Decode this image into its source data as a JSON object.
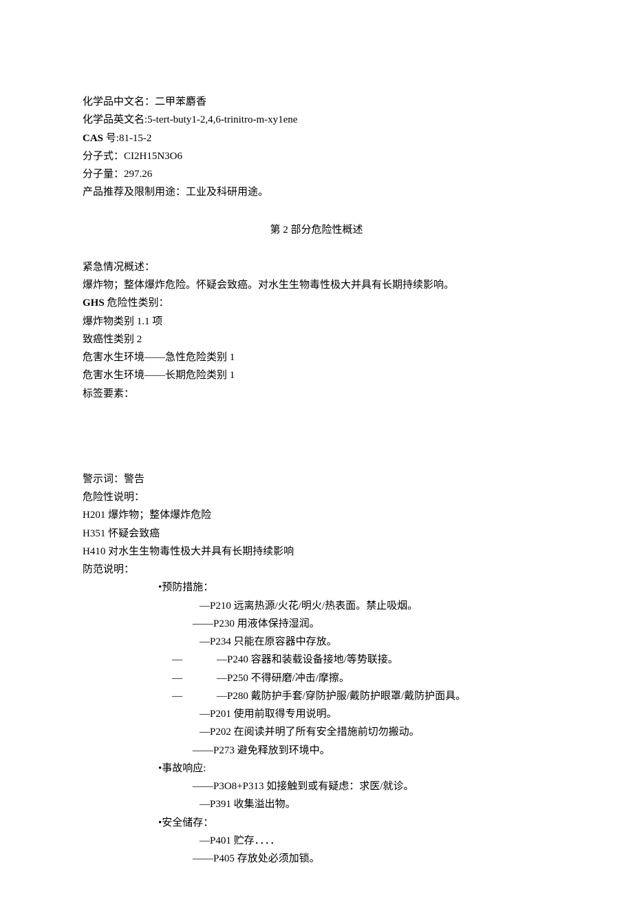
{
  "identification": {
    "cn_name_label": "化学品中文名：",
    "cn_name": "二甲苯麝香",
    "en_name_label": "化学品英文名:",
    "en_name": "5-tert-buty1-2,4,6-trinitro-m-xy1ene",
    "cas_label": "CAS",
    "cas_suffix": " 号:",
    "cas_no": "81-15-2",
    "formula_label": "分子式：",
    "formula": "CI2H15N3O6",
    "mw_label": "分子量：",
    "mw": "297.26",
    "use_label": "产品推荐及限制用途：工业及科研用途。"
  },
  "section2_title": "第 2 部分危险性概述",
  "hazard": {
    "emergency_label": "紧急情况概述：",
    "emergency_text": "爆炸物；整体爆炸危险。怀疑会致癌。对水生生物毒性极大并具有长期持续影响。",
    "ghs_label": "GHS",
    "ghs_suffix": " 危险性类别：",
    "cat1": "爆炸物类别 1.1 项",
    "cat2": "致癌性类别 2",
    "cat3": "危害水生环境——急性危险类别 1",
    "cat4": "危害水生环境——长期危险类别 1",
    "label_elements": "标签要素：",
    "signal_word": "警示词：警告",
    "hazard_stmt_label": "危险性说明：",
    "h201": "H201 爆炸物；整体爆炸危险",
    "h351": "H351 怀疑会致癌",
    "h410": "H410 对水生生物毒性极大并具有长期持续影响",
    "precaution_label": "防范说明：",
    "prevention_label": "•预防措施：",
    "p210": "—P210 远离热源/火花/明火/热表面。禁止吸烟。",
    "p230": "——P230 用液体保持湿润。",
    "p234": "—P234 只能在原容器中存放。",
    "p240_dash": "—",
    "p240": "—P240 容器和装载设备接地/等势联接。",
    "p250_dash": "—",
    "p250": "—P250 不得研磨/冲击/摩擦。",
    "p280_dash": "—",
    "p280": "—P280 戴防护手套/穿防护服/戴防护眼罩/戴防护面具。",
    "p201": "—P201 使用前取得专用说明。",
    "p202": "—P202 在阅读并明了所有安全措施前切勿搬动。",
    "p273": "——P273 避免释放到环境中。",
    "response_label": "•事故响应:",
    "p308": "——P3O8+P313 如接触到或有疑虑：求医/就诊。",
    "p391": "—P391 收集溢出物。",
    "storage_label": "•安全储存：",
    "p401": "—P401 贮存．．．．",
    "p405": "——P405 存放处必须加锁。"
  }
}
